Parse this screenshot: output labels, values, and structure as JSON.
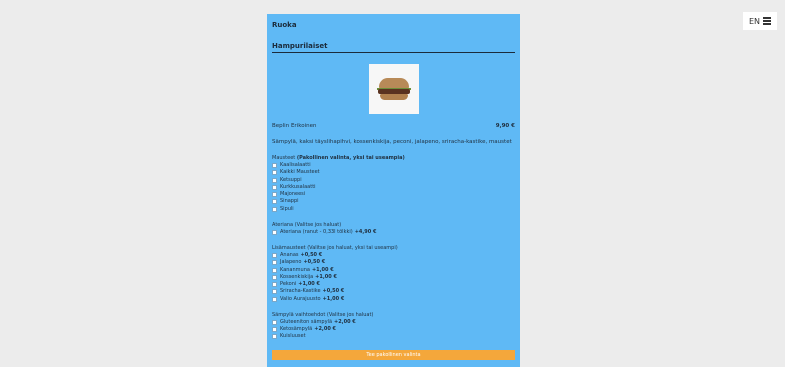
{
  "lang": {
    "code": "EN"
  },
  "menu": {
    "category": "Ruoka",
    "product_title": "Hampurilaiset",
    "item": {
      "name": "Beplin Erikoinen",
      "price": "9,90 €",
      "description": "Sämpylä, kaksi täyslihapihvi, kossenkiskija, peconi, jalapeno, sriracha-kastike, maustet"
    }
  },
  "groups": [
    {
      "title": "Mausteet",
      "title_suffix": "(Pakollinen valinta, yksi tai useampia)",
      "options": [
        {
          "label": "Kaalisalaatti",
          "price": ""
        },
        {
          "label": "Kaikki Mausteet",
          "price": ""
        },
        {
          "label": "Ketsuppi",
          "price": ""
        },
        {
          "label": "Kurkkusalaatti",
          "price": ""
        },
        {
          "label": "Majoneesi",
          "price": ""
        },
        {
          "label": "Sinappi",
          "price": ""
        },
        {
          "label": "Sipuli",
          "price": ""
        }
      ]
    },
    {
      "title": "Ateriana",
      "title_suffix": "(Valitse jos haluat)",
      "options": [
        {
          "label": "Ateriana (ranut - 0,33l tölkki)",
          "price": "+4,90 €"
        }
      ]
    },
    {
      "title": "Lisämausteet",
      "title_suffix": "(Valitse jos haluat, yksi tai useampi)",
      "options": [
        {
          "label": "Ananas",
          "price": "+0,50 €"
        },
        {
          "label": "Jalapeno",
          "price": "+0,50 €"
        },
        {
          "label": "Kananmuna",
          "price": "+1,00 €"
        },
        {
          "label": "Kossenkiskija",
          "price": "+1,00 €"
        },
        {
          "label": "Pekoni",
          "price": "+1,00 €"
        },
        {
          "label": "Sriracha-Kastike",
          "price": "+0,50 €"
        },
        {
          "label": "Valio Aurajuusto",
          "price": "+1,00 €"
        }
      ]
    },
    {
      "title": "Sämpylä vaihtoehdot",
      "title_suffix": "(Valitse jos haluat)",
      "options": [
        {
          "label": "Gluteeniton sämpylä",
          "price": "+2,00 €"
        },
        {
          "label": "Ketosämpylä",
          "price": "+2,00 €"
        },
        {
          "label": "Kuisluuset",
          "price": ""
        }
      ]
    }
  ],
  "order_button": {
    "label": "Tee pakollinen valinta"
  },
  "colors": {
    "panel": "#5fb9f5",
    "button": "#f4a73b",
    "page_bg": "#ececec"
  },
  "icons": {
    "menu": "hamburger-menu-icon",
    "product_image": "burger-photo"
  }
}
